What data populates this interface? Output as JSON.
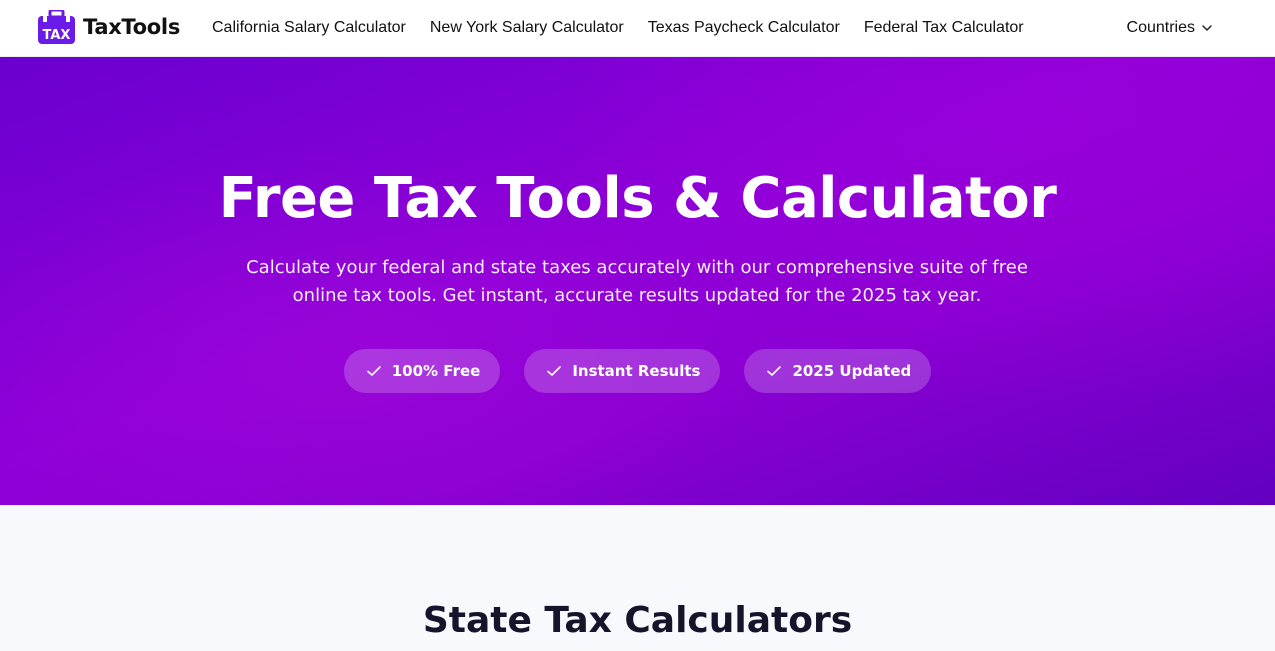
{
  "brand": {
    "logo_text": "TAX",
    "name": "TaxTools"
  },
  "nav": {
    "links": [
      {
        "label": "California Salary Calculator"
      },
      {
        "label": "New York Salary Calculator"
      },
      {
        "label": "Texas Paycheck Calculator"
      },
      {
        "label": "Federal Tax Calculator"
      }
    ],
    "countries_label": "Countries"
  },
  "hero": {
    "title": "Free Tax Tools & Calculator",
    "subtitle": "Calculate your federal and state taxes accurately with our comprehensive suite of free online tax tools. Get instant, accurate results updated for the 2025 tax year.",
    "badges": [
      {
        "label": "100% Free",
        "icon": "check-icon"
      },
      {
        "label": "Instant Results",
        "icon": "check-icon"
      },
      {
        "label": "2025 Updated",
        "icon": "check-icon"
      }
    ]
  },
  "section": {
    "title": "State Tax Calculators"
  },
  "colors": {
    "brand_purple": "#6a1be8",
    "hero_gradient_start": "#6a00d0",
    "hero_gradient_mid": "#9a00d8",
    "hero_gradient_end": "#6200c0",
    "section_background": "#f8f9fc",
    "section_title": "#14142b"
  }
}
